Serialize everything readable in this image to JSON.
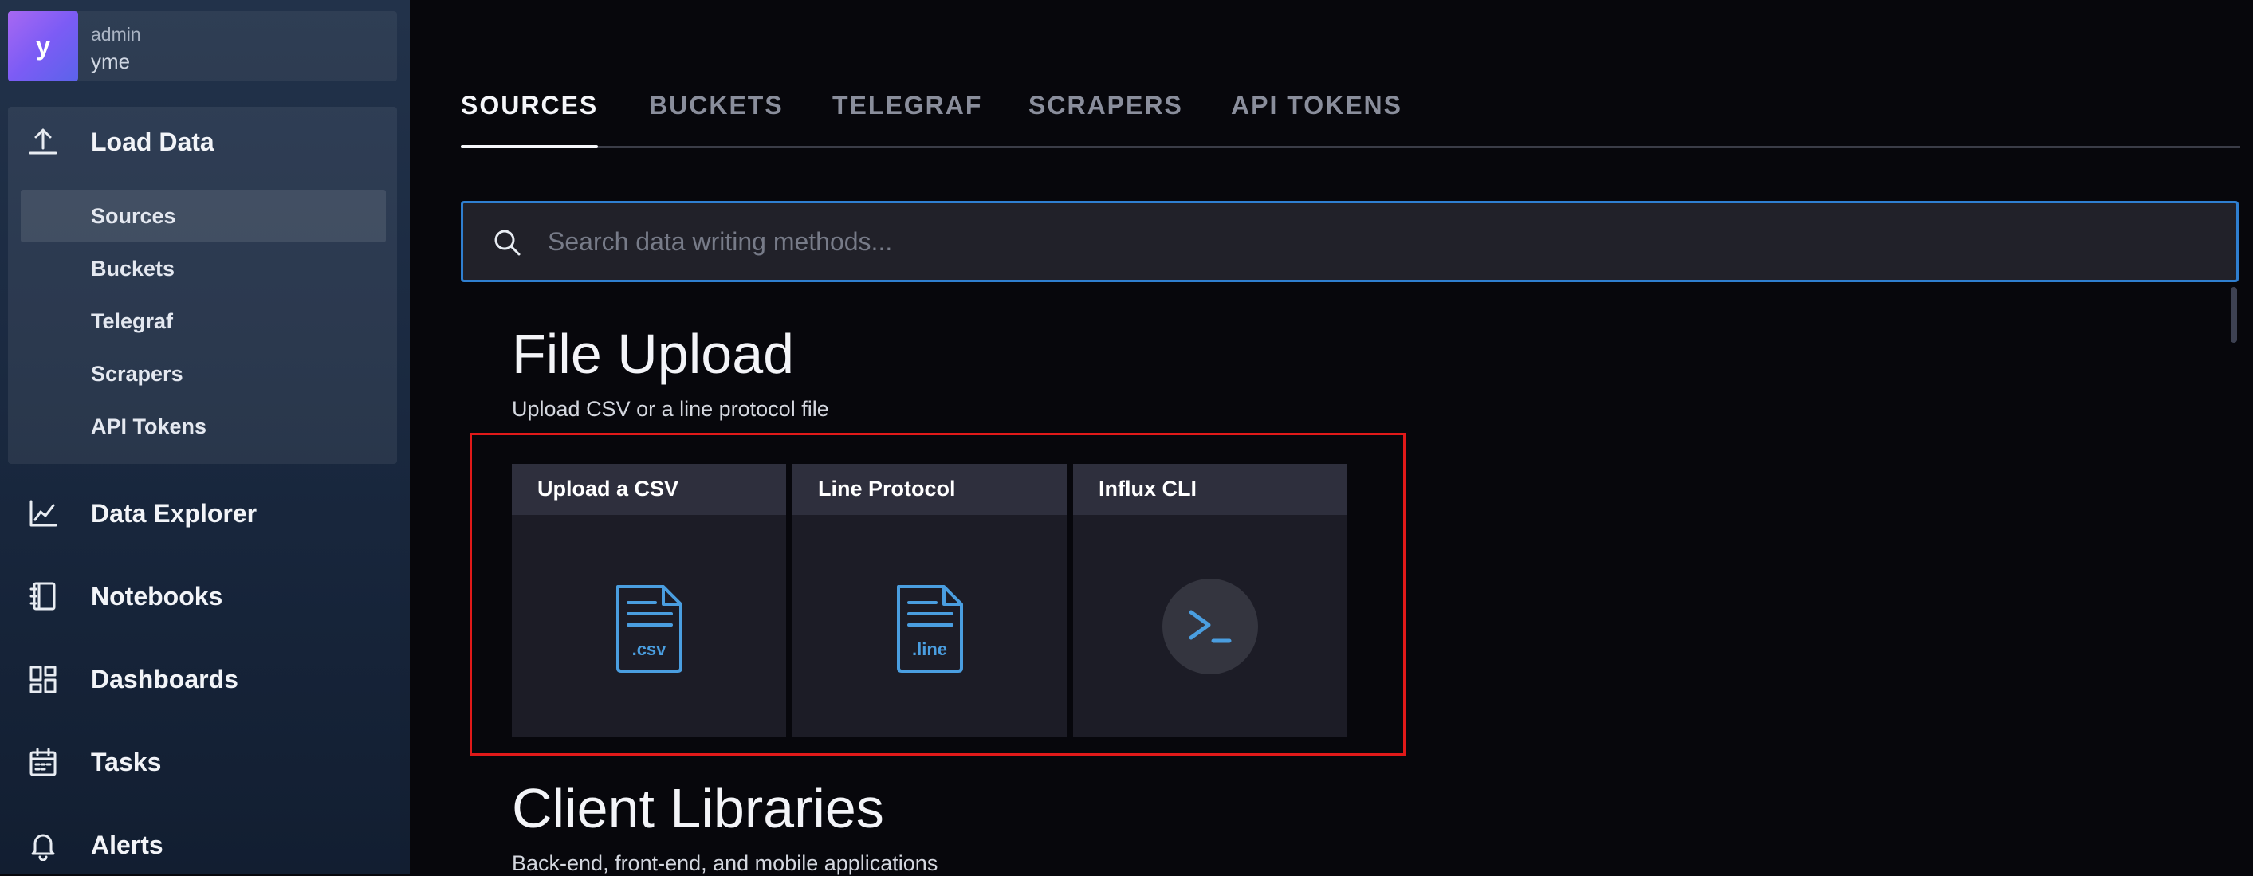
{
  "user": {
    "avatar_letter": "y",
    "role": "admin",
    "org": "yme"
  },
  "sidebar": {
    "load_data": {
      "label": "Load Data",
      "icon": "upload-icon",
      "sub_items": [
        {
          "label": "Sources",
          "selected": true
        },
        {
          "label": "Buckets"
        },
        {
          "label": "Telegraf"
        },
        {
          "label": "Scrapers"
        },
        {
          "label": "API Tokens"
        }
      ]
    },
    "items": [
      {
        "label": "Data Explorer",
        "icon": "graph-icon"
      },
      {
        "label": "Notebooks",
        "icon": "notebook-icon"
      },
      {
        "label": "Dashboards",
        "icon": "dashboard-icon"
      },
      {
        "label": "Tasks",
        "icon": "calendar-icon"
      },
      {
        "label": "Alerts",
        "icon": "bell-icon"
      }
    ]
  },
  "tabs": [
    {
      "label": "SOURCES",
      "active": true
    },
    {
      "label": "BUCKETS"
    },
    {
      "label": "TELEGRAF"
    },
    {
      "label": "SCRAPERS"
    },
    {
      "label": "API TOKENS"
    }
  ],
  "search": {
    "placeholder": "Search data writing methods...",
    "value": ""
  },
  "file_upload": {
    "title": "File Upload",
    "subtitle": "Upload CSV or a line protocol file",
    "cards": [
      {
        "title": "Upload a CSV",
        "icon": "csv-file-icon",
        "ext": ".csv"
      },
      {
        "title": "Line Protocol",
        "icon": "line-file-icon",
        "ext": ".line"
      },
      {
        "title": "Influx CLI",
        "icon": "terminal-icon"
      }
    ]
  },
  "client_libraries": {
    "title": "Client Libraries",
    "subtitle": "Back-end, front-end, and mobile applications"
  },
  "colors": {
    "accent_blue": "#4a9ee0",
    "highlight_red": "#e01919",
    "avatar_gradient_start": "#a768f2",
    "avatar_gradient_end": "#5b63ea"
  }
}
